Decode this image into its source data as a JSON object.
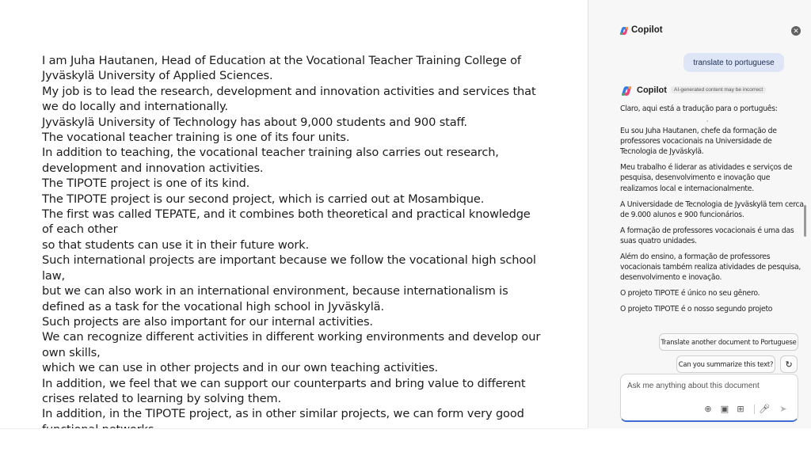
{
  "document": {
    "lines": [
      "I am Juha Hautanen, Head of Education at the Vocational Teacher Training College of",
      "Jyväskylä University of Applied Sciences.",
      "My job is to lead the research, development and innovation activities and services that",
      "we do locally and internationally.",
      "Jyväskylä University of Technology has about 9,000 students and 900 staff.",
      "The vocational teacher training is one of its four units.",
      "In addition to teaching, the vocational teacher training also carries out research,",
      "development and innovation activities.",
      "The TIPOTE project is one of its kind.",
      "The TIPOTE project is our second project, which is carried out at Mosambique.",
      "The first was called TEPATE, and it combines both theoretical and practical knowledge",
      "of each other",
      "so that students can use it in their future work.",
      "Such international projects are important because we follow the vocational high school",
      "law,",
      "but we can also work in an international environment, because internationalism is",
      "defined as a task for the vocational high school in Jyväskylä.",
      "Such projects are also important for our internal activities.",
      "We can recognize different activities in different working environments and develop our",
      "own skills,",
      "which we can use in other projects and in our own teaching activities.",
      "In addition, we feel that we can support our counterparts and bring value to different",
      "crises related to learning by solving them.",
      "In addition, in the TIPOTE project, as in other similar projects, we can form very good",
      "functional networks."
    ]
  },
  "copilot": {
    "title": "Copilot",
    "user_message": "translate to portuguese",
    "response_name": "Copilot",
    "badge": "AI-generated content may be incorrect",
    "intro": "Claro, aqui está a tradução para o português:",
    "dot": "·",
    "paragraphs": [
      "Eu sou Juha Hautanen, chefe da formação de professores vocacionais na Universidade de Tecnologia de Jyväskylä.",
      "Meu trabalho é liderar as atividades e serviços de pesquisa, desenvolvimento e inovação que realizamos local e internacionalmente.",
      "A Universidade de Tecnologia de Jyväskylä tem cerca de 9.000 alunos e 900 funcionários.",
      "A formação de professores vocacionais é uma das suas quatro unidades.",
      "Além do ensino, a formação de professores vocacionais também realiza atividades de pesquisa, desenvolvimento e inovação.",
      "O projeto TIPOTE é único no seu gênero.",
      "O projeto TIPOTE é o nosso segundo projeto"
    ],
    "suggestions": [
      "Translate another document to Portuguese",
      "Can you summarize this text?"
    ],
    "input_placeholder": "Ask me anything about this document"
  },
  "colors": {
    "accent": "#3f6bd6",
    "user_bubble": "#dde5f7",
    "pane_bg": "#f7f7f7"
  },
  "icons": [
    "copilot-logo-icon",
    "close-icon",
    "refresh-icon",
    "microphone-icon",
    "send-icon",
    "attachment-icon",
    "image-icon",
    "plugin-icon"
  ]
}
